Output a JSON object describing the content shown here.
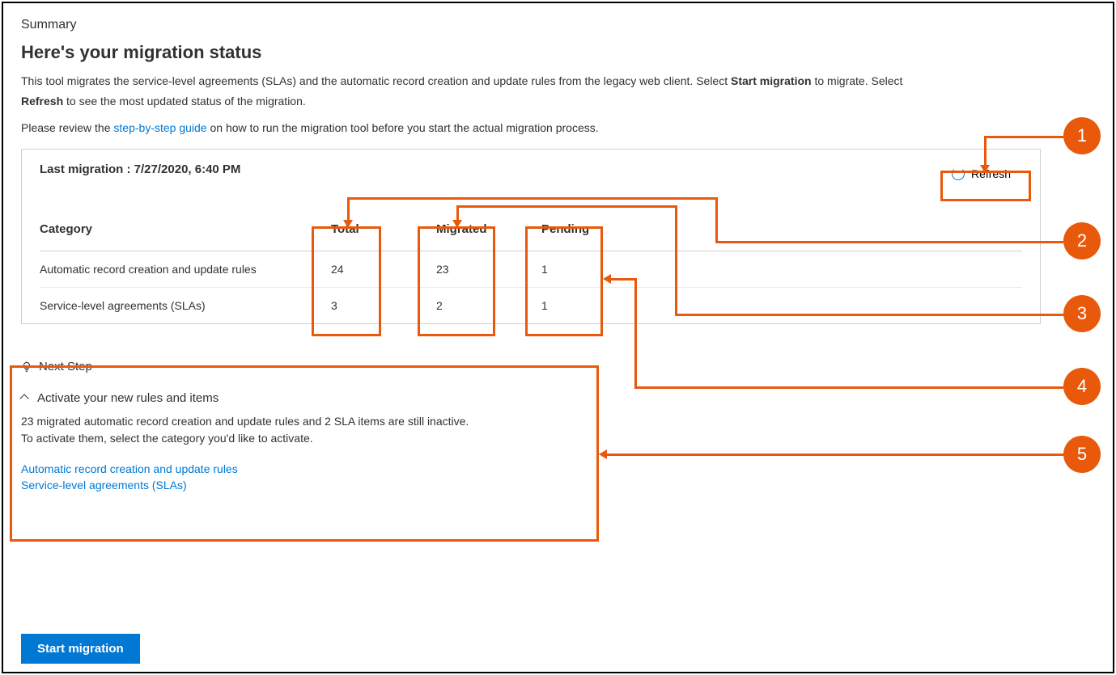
{
  "header": {
    "summary_label": "Summary",
    "title": "Here's your migration status",
    "desc_prefix": "This tool migrates the service-level agreements (SLAs) and the automatic record creation and update rules from the legacy web client. Select ",
    "desc_bold1": "Start migration",
    "desc_mid": " to migrate. Select ",
    "desc_bold2": "Refresh",
    "desc_suffix": " to see the most updated status of the migration.",
    "review_prefix": "Please review the ",
    "guide_link": "step-by-step guide",
    "review_suffix": " on how to run the migration tool before you start the actual migration process."
  },
  "status": {
    "last_migration_label": "Last migration : 7/27/2020, 6:40 PM",
    "refresh_label": "Refresh",
    "columns": {
      "category": "Category",
      "total": "Total",
      "migrated": "Migrated",
      "pending": "Pending"
    },
    "rows": [
      {
        "category": "Automatic record creation and update rules",
        "total": "24",
        "migrated": "23",
        "pending": "1"
      },
      {
        "category": "Service-level agreements (SLAs)",
        "total": "3",
        "migrated": "2",
        "pending": "1"
      }
    ]
  },
  "next_step": {
    "heading": "Next Step",
    "accordion_title": "Activate your new rules and items",
    "body_line1": "23 migrated automatic record creation and update rules and 2 SLA items are still inactive.",
    "body_line2": "To activate them, select the category you'd like to activate.",
    "link1": "Automatic record creation and update rules",
    "link2": "Service-level agreements (SLAs)"
  },
  "footer": {
    "start_button": "Start migration"
  },
  "callouts": {
    "c1": "1",
    "c2": "2",
    "c3": "3",
    "c4": "4",
    "c5": "5"
  }
}
